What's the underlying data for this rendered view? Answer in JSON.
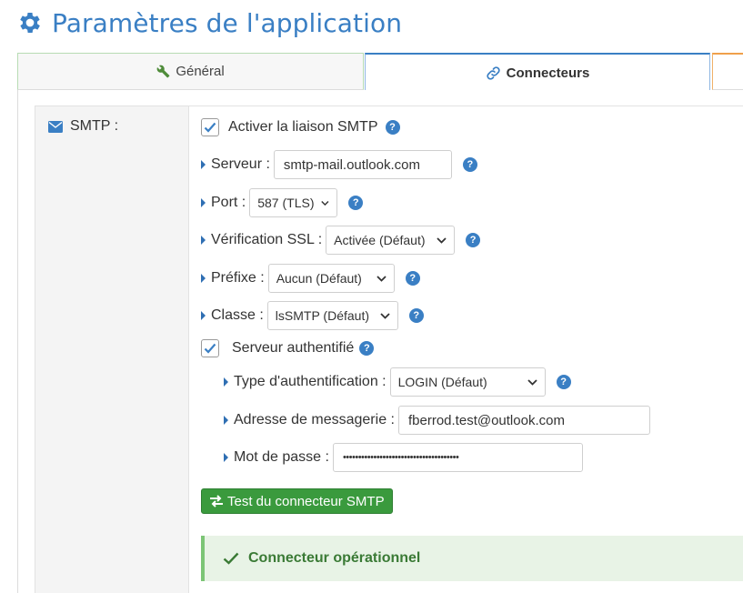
{
  "page": {
    "title": "Paramètres de l'application",
    "icon": "gear-icon"
  },
  "tabs": [
    {
      "label": "Général",
      "icon": "wrench-icon",
      "active": false
    },
    {
      "label": "Connecteurs",
      "icon": "link-icon",
      "active": true
    },
    {
      "label": "",
      "active": false
    }
  ],
  "smtp": {
    "section_label": "SMTP :",
    "section_icon": "envelope-icon",
    "enable": {
      "label": "Activer la liaison SMTP",
      "checked": true
    },
    "server": {
      "label": "Serveur :",
      "value": "smtp-mail.outlook.com"
    },
    "port": {
      "label": "Port :",
      "selected": "587 (TLS)"
    },
    "ssl": {
      "label": "Vérification SSL :",
      "selected": "Activée (Défaut)"
    },
    "prefix": {
      "label": "Préfixe :",
      "selected": "Aucun (Défaut)"
    },
    "class": {
      "label": "Classe :",
      "selected": "lsSMTP (Défaut)"
    },
    "auth": {
      "label": "Serveur authentifié",
      "checked": true
    },
    "auth_type": {
      "label": "Type d'authentification :",
      "selected": "LOGIN (Défaut)"
    },
    "email": {
      "label": "Adresse de messagerie :",
      "value": "fberrod.test@outlook.com"
    },
    "password": {
      "label": "Mot de passe :",
      "value": "••••••••••••••••••••••••••••••••••••••"
    },
    "test_button": "Test du connecteur SMTP",
    "status": "Connecteur opérationnel"
  },
  "colors": {
    "accent": "#3a7fc4",
    "success": "#3a9a3d",
    "alert_bg": "#e8f3e6"
  }
}
